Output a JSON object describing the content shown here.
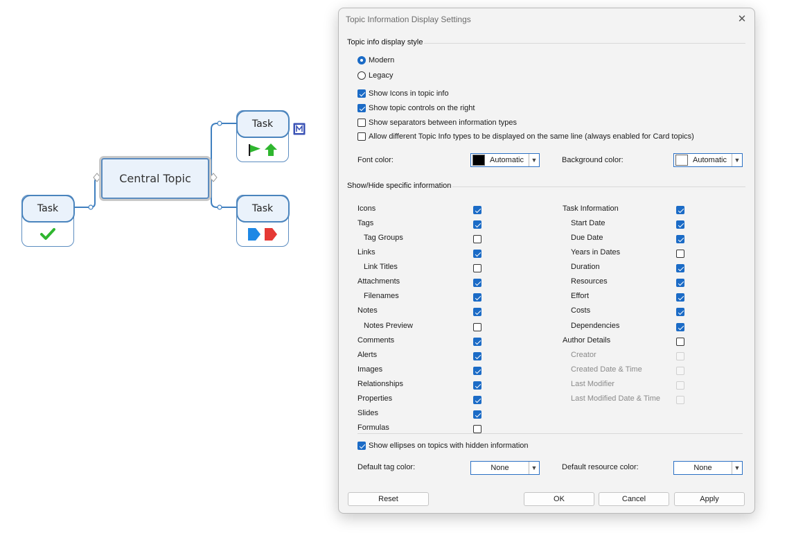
{
  "mindmap": {
    "central": "Central Topic",
    "tasks": [
      "Task",
      "Task",
      "Task"
    ]
  },
  "dialog": {
    "title": "Topic Information Display Settings",
    "close_icon": "close-icon",
    "style_group": "Topic info display style",
    "style_options": [
      {
        "label": "Modern",
        "selected": true
      },
      {
        "label": "Legacy",
        "selected": false
      }
    ],
    "general_options": [
      {
        "label": "Show Icons in topic info",
        "checked": true
      },
      {
        "label": "Show topic controls on the right",
        "checked": true
      },
      {
        "label": "Show separators between information types",
        "checked": false
      },
      {
        "label": "Allow different Topic Info types to be displayed on the same line (always enabled for Card topics)",
        "checked": false
      }
    ],
    "font_color_label": "Font color:",
    "font_color_value": "Automatic",
    "font_color_swatch": "#000000",
    "bg_color_label": "Background color:",
    "bg_color_value": "Automatic",
    "bg_color_swatch": "#ffffff",
    "showhide_group": "Show/Hide specific information",
    "left_items": [
      {
        "label": "Icons",
        "checked": true,
        "indent": false
      },
      {
        "label": "Tags",
        "checked": true,
        "indent": false
      },
      {
        "label": "Tag Groups",
        "checked": false,
        "indent": true
      },
      {
        "label": "Links",
        "checked": true,
        "indent": false
      },
      {
        "label": "Link Titles",
        "checked": false,
        "indent": true
      },
      {
        "label": "Attachments",
        "checked": true,
        "indent": false
      },
      {
        "label": "Filenames",
        "checked": true,
        "indent": true
      },
      {
        "label": "Notes",
        "checked": true,
        "indent": false
      },
      {
        "label": "Notes Preview",
        "checked": false,
        "indent": true
      },
      {
        "label": "Comments",
        "checked": true,
        "indent": false
      },
      {
        "label": "Alerts",
        "checked": true,
        "indent": false
      },
      {
        "label": "Images",
        "checked": true,
        "indent": false
      },
      {
        "label": "Relationships",
        "checked": true,
        "indent": false
      },
      {
        "label": "Properties",
        "checked": true,
        "indent": false
      },
      {
        "label": "Slides",
        "checked": true,
        "indent": false
      },
      {
        "label": "Formulas",
        "checked": false,
        "indent": false
      }
    ],
    "right_items": [
      {
        "label": "Task Information",
        "checked": true,
        "indent": false,
        "disabled": false
      },
      {
        "label": "Start Date",
        "checked": true,
        "indent": true,
        "disabled": false
      },
      {
        "label": "Due Date",
        "checked": true,
        "indent": true,
        "disabled": false
      },
      {
        "label": "Years in Dates",
        "checked": false,
        "indent": true,
        "disabled": false
      },
      {
        "label": "Duration",
        "checked": true,
        "indent": true,
        "disabled": false
      },
      {
        "label": "Resources",
        "checked": true,
        "indent": true,
        "disabled": false
      },
      {
        "label": "Effort",
        "checked": true,
        "indent": true,
        "disabled": false
      },
      {
        "label": "Costs",
        "checked": true,
        "indent": true,
        "disabled": false
      },
      {
        "label": "Dependencies",
        "checked": true,
        "indent": true,
        "disabled": false
      },
      {
        "label": "Author Details",
        "checked": false,
        "indent": false,
        "disabled": false
      },
      {
        "label": "Creator",
        "checked": false,
        "indent": true,
        "disabled": true
      },
      {
        "label": "Created Date & Time",
        "checked": false,
        "indent": true,
        "disabled": true
      },
      {
        "label": "Last Modifier",
        "checked": false,
        "indent": true,
        "disabled": true
      },
      {
        "label": "Last Modified Date & Time",
        "checked": false,
        "indent": true,
        "disabled": true
      }
    ],
    "ellipses_label": "Show ellipses on topics with hidden information",
    "ellipses_checked": true,
    "tag_color_label": "Default tag color:",
    "tag_color_value": "None",
    "resource_color_label": "Default resource color:",
    "resource_color_value": "None",
    "buttons": {
      "reset": "Reset",
      "ok": "OK",
      "cancel": "Cancel",
      "apply": "Apply"
    }
  }
}
